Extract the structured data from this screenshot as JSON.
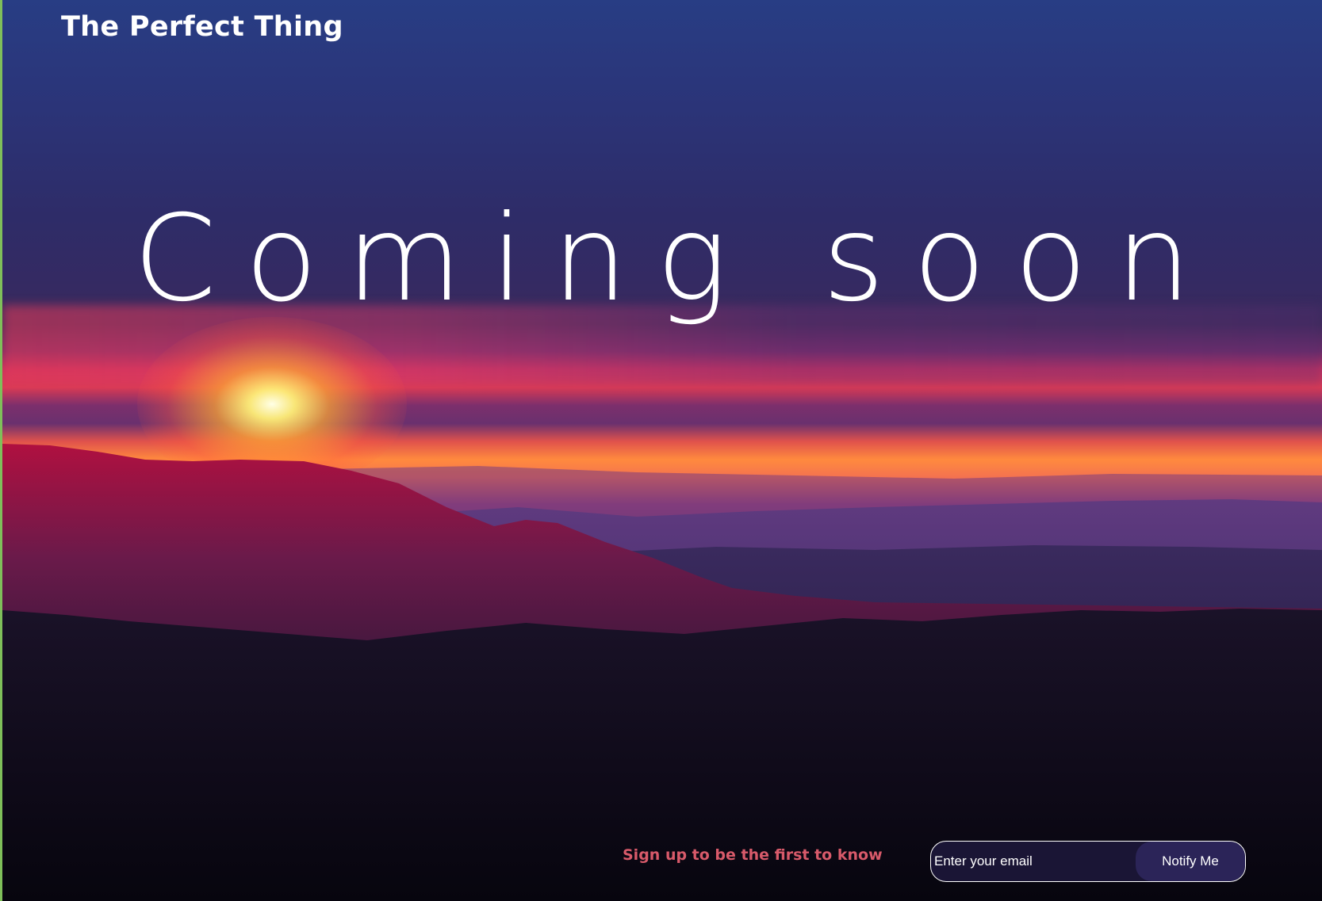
{
  "header": {
    "brand": "The Perfect Thing"
  },
  "hero": {
    "headline": "Coming soon"
  },
  "signup": {
    "prompt": "Sign up to be the first to know",
    "email_placeholder": "Enter your email",
    "email_value": "",
    "button_label": "Notify Me"
  },
  "colors": {
    "brand_text": "#ffffff",
    "signup_prompt": "#d85a6a",
    "form_background": "#1a1535",
    "button_background": "#2b2458"
  },
  "icons": {
    "background": "sunset-mountains-photo"
  }
}
